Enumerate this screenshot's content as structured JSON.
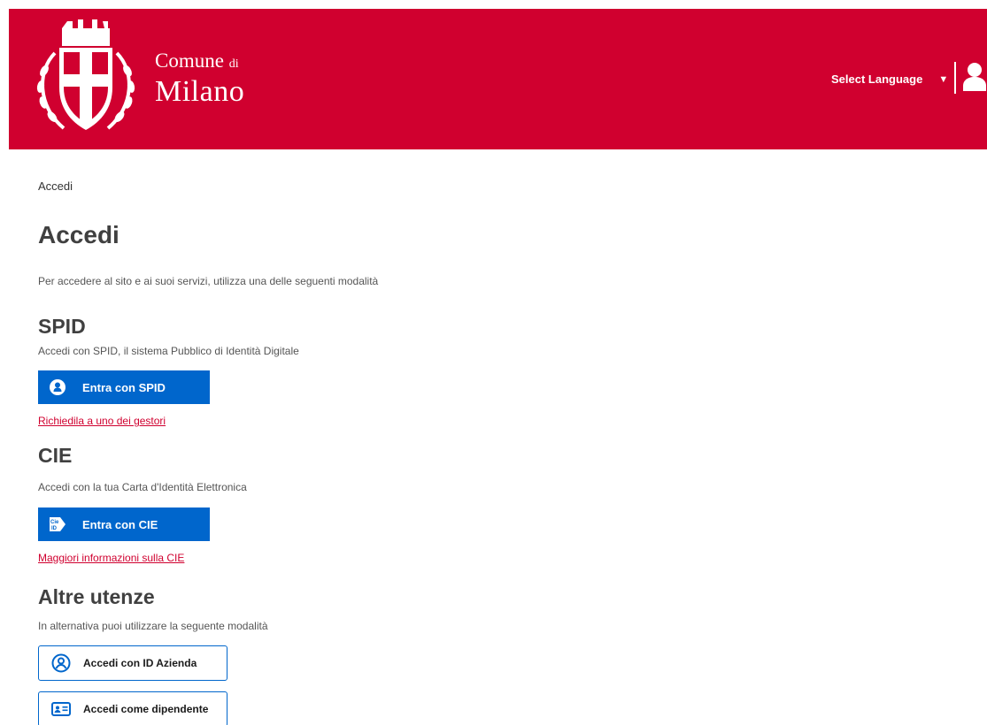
{
  "header": {
    "brand_line1": "Comune",
    "brand_di": "di",
    "brand_line2": "Milano",
    "language_label": "Select Language",
    "language_arrow": "▼",
    "colors": {
      "brand_red": "#d0002f",
      "primary_blue": "#0066cc"
    },
    "icons": {
      "logo": "milano-crest-icon",
      "user": "user-icon"
    }
  },
  "breadcrumb": "Accedi",
  "page_title": "Accedi",
  "intro": "Per accedere al sito e ai suoi servizi, utilizza una delle seguenti modalità",
  "spid": {
    "title": "SPID",
    "description": "Accedi con SPID, il sistema Pubblico di Identità Digitale",
    "button_label": "Entra con SPID",
    "button_icon": "spid-user-icon",
    "link": "Richiedila a uno dei gestori"
  },
  "cie": {
    "title": "CIE",
    "description": "Accedi con la tua Carta d'Identità Elettronica",
    "button_label": "Entra con CIE",
    "button_icon": "cie-id-icon",
    "icon_text": "Cie ID",
    "link": "Maggiori informazioni sulla CIE"
  },
  "altre": {
    "title": "Altre utenze",
    "description": "In alternativa puoi utilizzare la seguente modalità",
    "btn_azienda": "Accedi con ID Azienda",
    "btn_azienda_icon": "user-circle-icon",
    "btn_dipendente": "Accedi come dipendente",
    "btn_dipendente_icon": "id-card-icon"
  }
}
